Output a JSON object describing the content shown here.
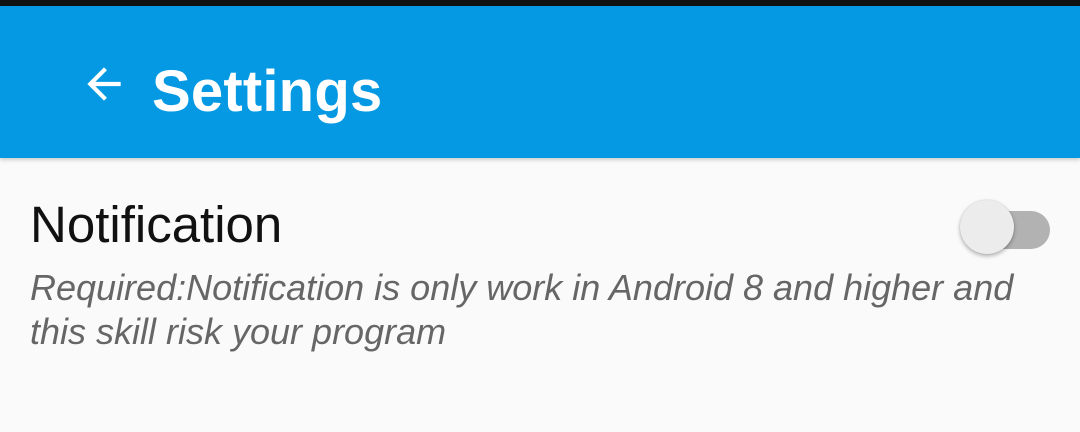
{
  "toolbar": {
    "back_icon": "arrow-back-icon",
    "title": "Settings",
    "background_color": "#0599e3",
    "foreground_color": "#ffffff"
  },
  "preferences": [
    {
      "title": "Notification",
      "summary": "Required:Notification is only work in Android 8 and higher and this skill risk your program",
      "switch_on": false,
      "switch_track_color": "#b2b2b2",
      "switch_thumb_color": "#ececec"
    }
  ]
}
